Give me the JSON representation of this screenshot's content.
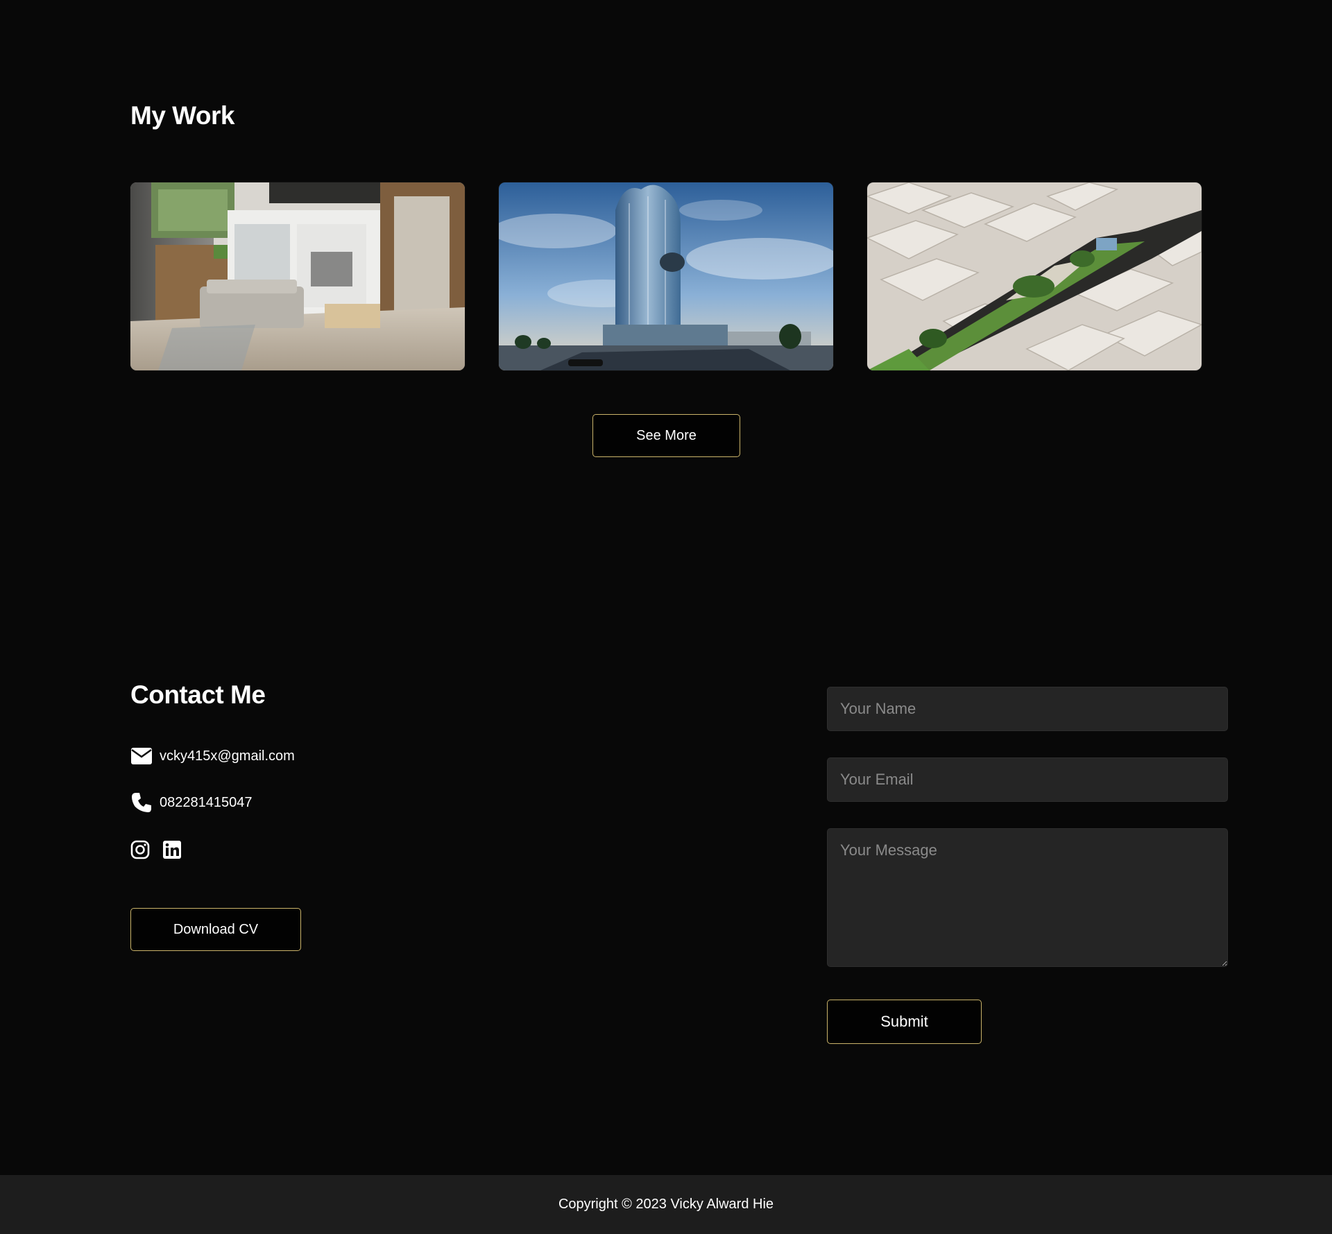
{
  "work": {
    "title": "My Work",
    "see_more_label": "See More",
    "images": [
      {
        "name": "interior-living-room-render"
      },
      {
        "name": "glass-tower-exterior-render"
      },
      {
        "name": "aerial-site-plan-render"
      }
    ]
  },
  "contact": {
    "title": "Contact Me",
    "email": "vcky415x@gmail.com",
    "phone": "082281415047",
    "download_cv_label": "Download CV",
    "social_icons": [
      "instagram-icon",
      "linkedin-icon"
    ]
  },
  "form": {
    "name_placeholder": "Your Name",
    "email_placeholder": "Your Email",
    "message_placeholder": "Your Message",
    "submit_label": "Submit"
  },
  "footer": {
    "copyright": "Copyright © 2023 Vicky Alward Hie"
  },
  "colors": {
    "background": "#080808",
    "button_border": "#cbb46a",
    "field_background": "#252525",
    "footer_background": "#1d1d1d"
  }
}
